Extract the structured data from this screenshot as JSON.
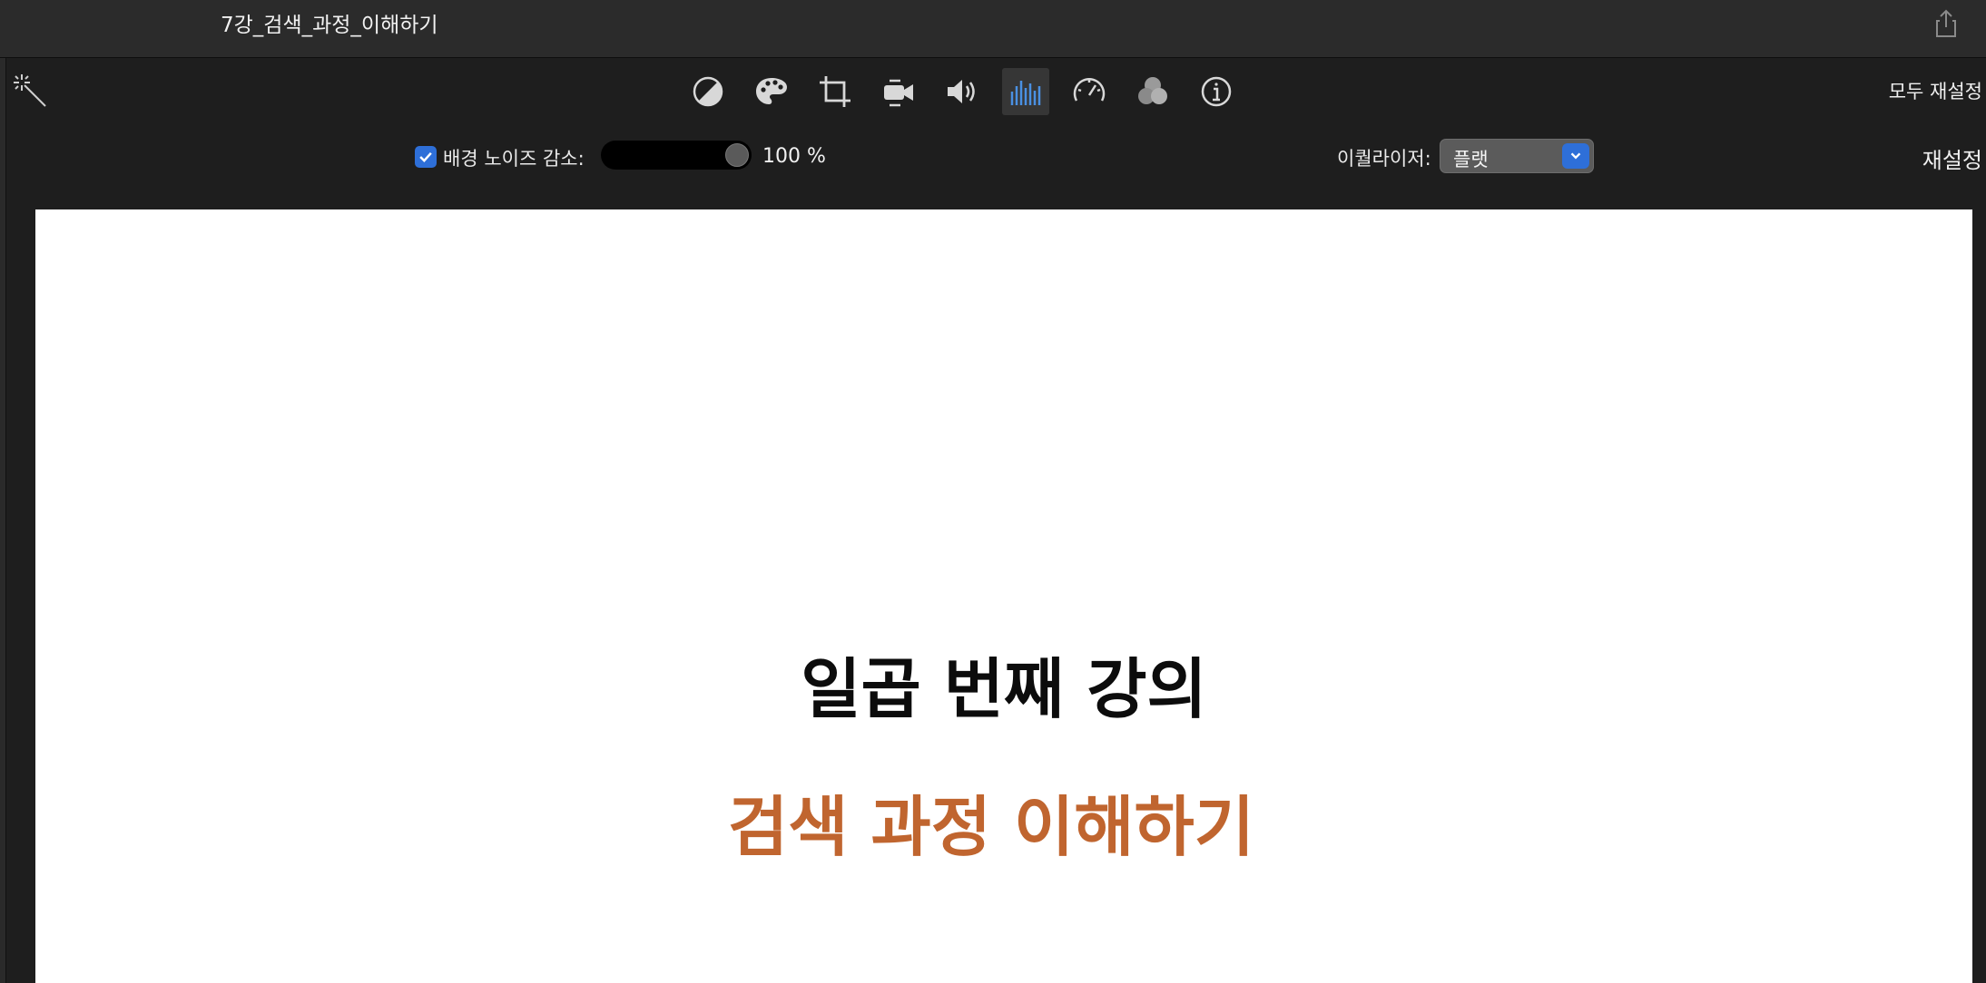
{
  "window": {
    "title": "7강_검색_과정_이해하기"
  },
  "toolbar": {
    "tools": [
      {
        "name": "color-balance-icon"
      },
      {
        "name": "color-correction-icon"
      },
      {
        "name": "crop-icon"
      },
      {
        "name": "stabilization-icon"
      },
      {
        "name": "volume-icon"
      },
      {
        "name": "noise-reduction-equalizer-icon",
        "active": true
      },
      {
        "name": "speed-icon"
      },
      {
        "name": "clip-filter-icon"
      },
      {
        "name": "info-icon"
      }
    ],
    "reset_all_label": "모두 재설정",
    "accent_color": "#4a90e2"
  },
  "noise_reduction": {
    "checked": true,
    "label": "배경 노이즈 감소:",
    "value_text": "100  %",
    "level": 1.0
  },
  "equalizer": {
    "label": "이퀄라이저:",
    "selected": "플랫"
  },
  "reset_label": "재설정",
  "viewer": {
    "title": "일곱 번째 강의",
    "subtitle": "검색 과정 이해하기",
    "subtitle_color": "#c0652f"
  }
}
